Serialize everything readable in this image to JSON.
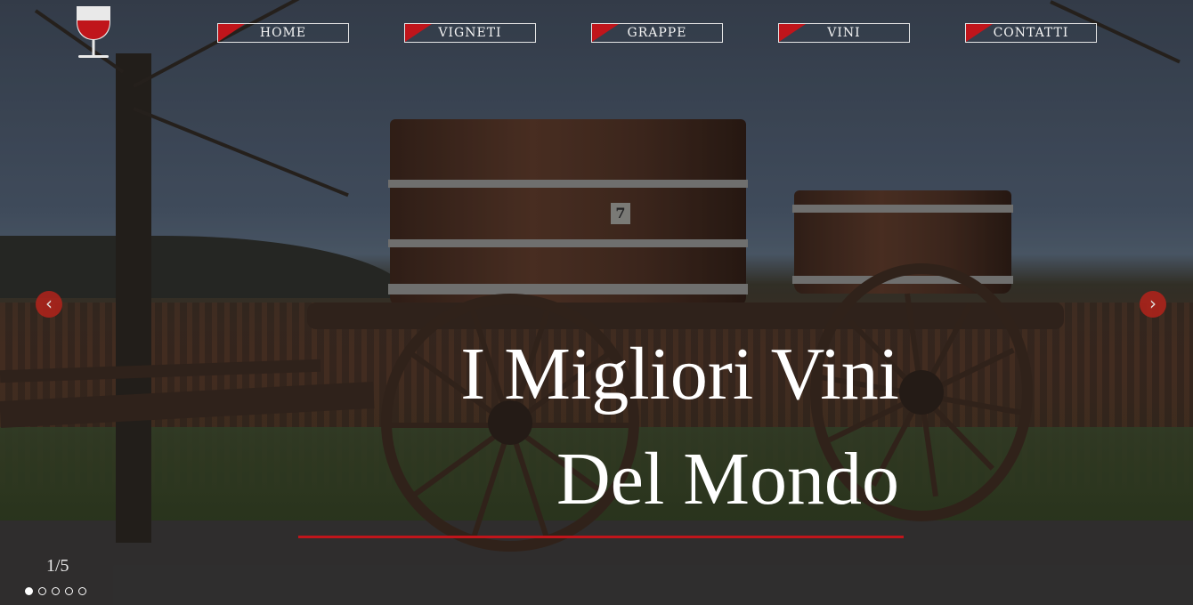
{
  "nav": {
    "items": [
      {
        "label": "HOME"
      },
      {
        "label": "VIGNETI"
      },
      {
        "label": "GRAPPE"
      },
      {
        "label": "VINI"
      },
      {
        "label": "CONTATTI"
      }
    ]
  },
  "hero": {
    "headline_line1": "I Migliori Vini",
    "headline_line2": "Del Mondo",
    "barrel_number": "7",
    "image_subject": "wooden cart carrying wine barrels in front of a vineyard"
  },
  "slider": {
    "counter": "1/5",
    "total_slides": 5,
    "active_slide": 1,
    "prev_icon": "chevron-left-icon",
    "next_icon": "chevron-right-icon"
  },
  "colors": {
    "accent": "#c0151b",
    "text": "#ffffff"
  },
  "logo": {
    "icon": "wine-glass-icon"
  }
}
